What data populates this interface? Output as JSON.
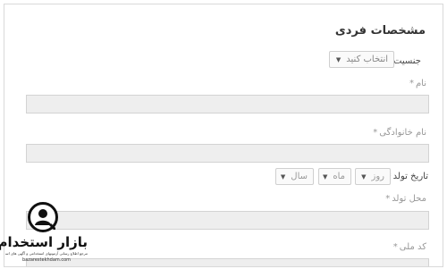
{
  "form": {
    "section_title": "مشخصات فردی",
    "gender": {
      "label": "جنسیت",
      "required_mark": "*",
      "select_value": "انتخاب کنید"
    },
    "first_name": {
      "label": "نام",
      "required_mark": "*"
    },
    "last_name": {
      "label": "نام خانوادگی",
      "required_mark": "*"
    },
    "birth_date": {
      "label": "تاریخ تولد",
      "required_mark": "*",
      "day_value": "روز",
      "month_value": "ماه",
      "year_value": "سال"
    },
    "birth_place": {
      "label": "محل تولد",
      "required_mark": "*"
    },
    "national_code": {
      "label": "کد ملی",
      "required_mark": "*"
    }
  },
  "watermark": {
    "brand": "بازار استخدام",
    "tagline": "مرجع اطلاع رسانی آزمونهای استخدامی و آگهی های استخدامی",
    "url": "bazarestekhdam.com"
  }
}
